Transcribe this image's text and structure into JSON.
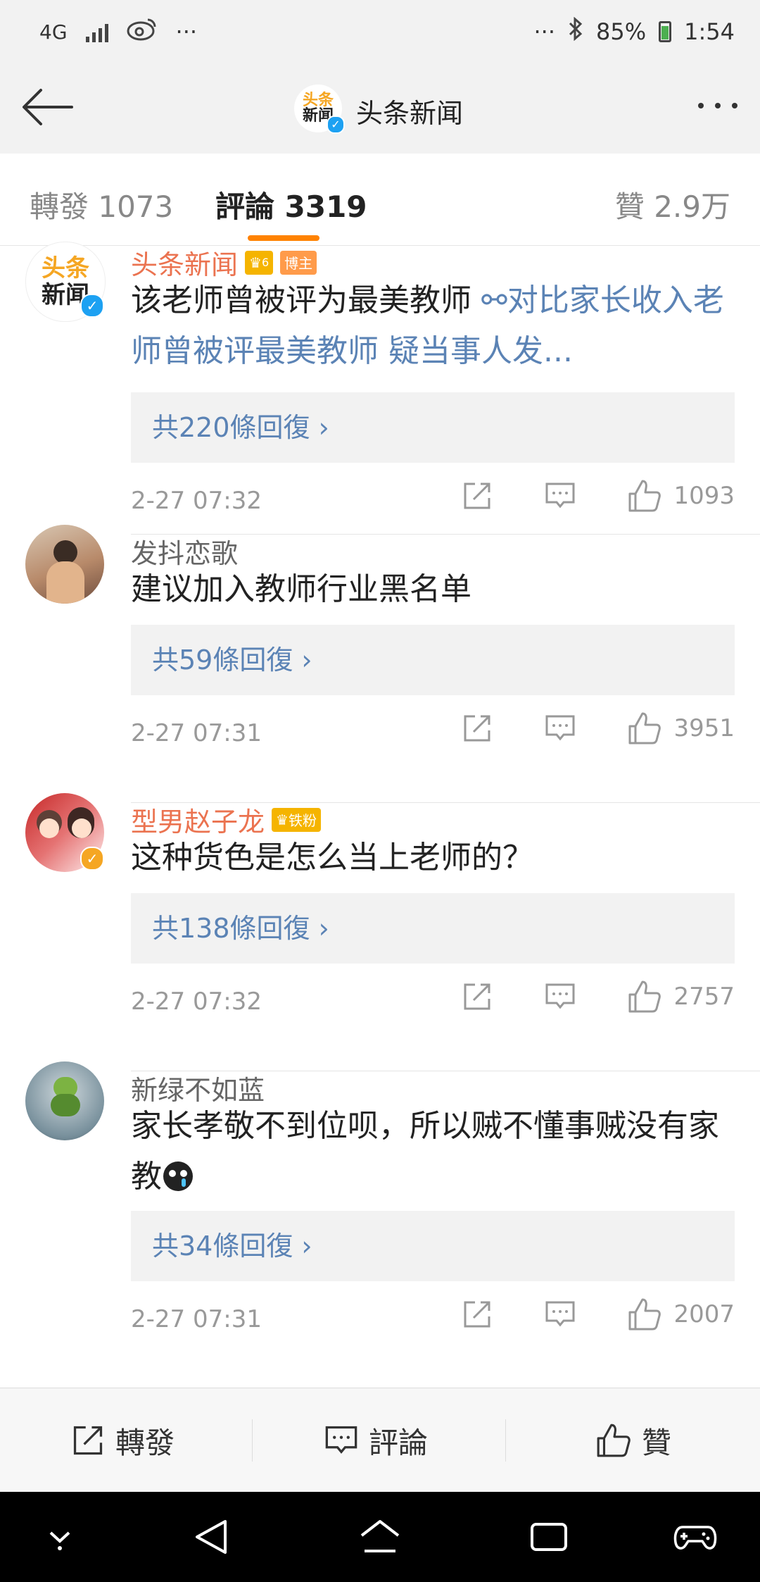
{
  "status": {
    "network": "4G",
    "battery": "85%",
    "time": "1:54",
    "more": "···"
  },
  "header": {
    "title": "头条新闻",
    "logo_line1": "头条",
    "logo_line2": "新闻",
    "more_icon": "more-dots-icon"
  },
  "tabs": [
    {
      "label": "轉發 1073",
      "active": false
    },
    {
      "label": "評論 3319",
      "active": true
    },
    {
      "label": "贊 2.9万",
      "active": false
    }
  ],
  "comments": [
    {
      "user": "头条新闻",
      "badge_level": "6",
      "badge_role": "博主",
      "text": "该老师曾被评为最美教师 ",
      "link_text": "对比家长收入老师曾被评最美教师 疑当事人发...",
      "replies": "共220條回復 ›",
      "time": "2-27 07:32",
      "likes": "1093"
    },
    {
      "user": "发抖恋歌",
      "text": "建议加入教师行业黑名单",
      "replies": "共59條回復 ›",
      "time": "2-27 07:31",
      "likes": "3951"
    },
    {
      "user": "型男赵子龙",
      "badge_role": "铁粉",
      "text": "这种货色是怎么当上老师的？",
      "replies": "共138條回復 ›",
      "time": "2-27 07:32",
      "likes": "2757"
    },
    {
      "user": "新绿不如蓝",
      "text": "家长孝敬不到位呗，所以贼不懂事贼没有家教",
      "replies": "共34條回復 ›",
      "time": "2-27 07:31",
      "likes": "2007"
    }
  ],
  "bottom": {
    "repost": "轉發",
    "comment": "評論",
    "like": "贊"
  },
  "colors": {
    "accent": "#ff8200",
    "link": "#5b83b5",
    "username_orange": "#eb7350"
  }
}
